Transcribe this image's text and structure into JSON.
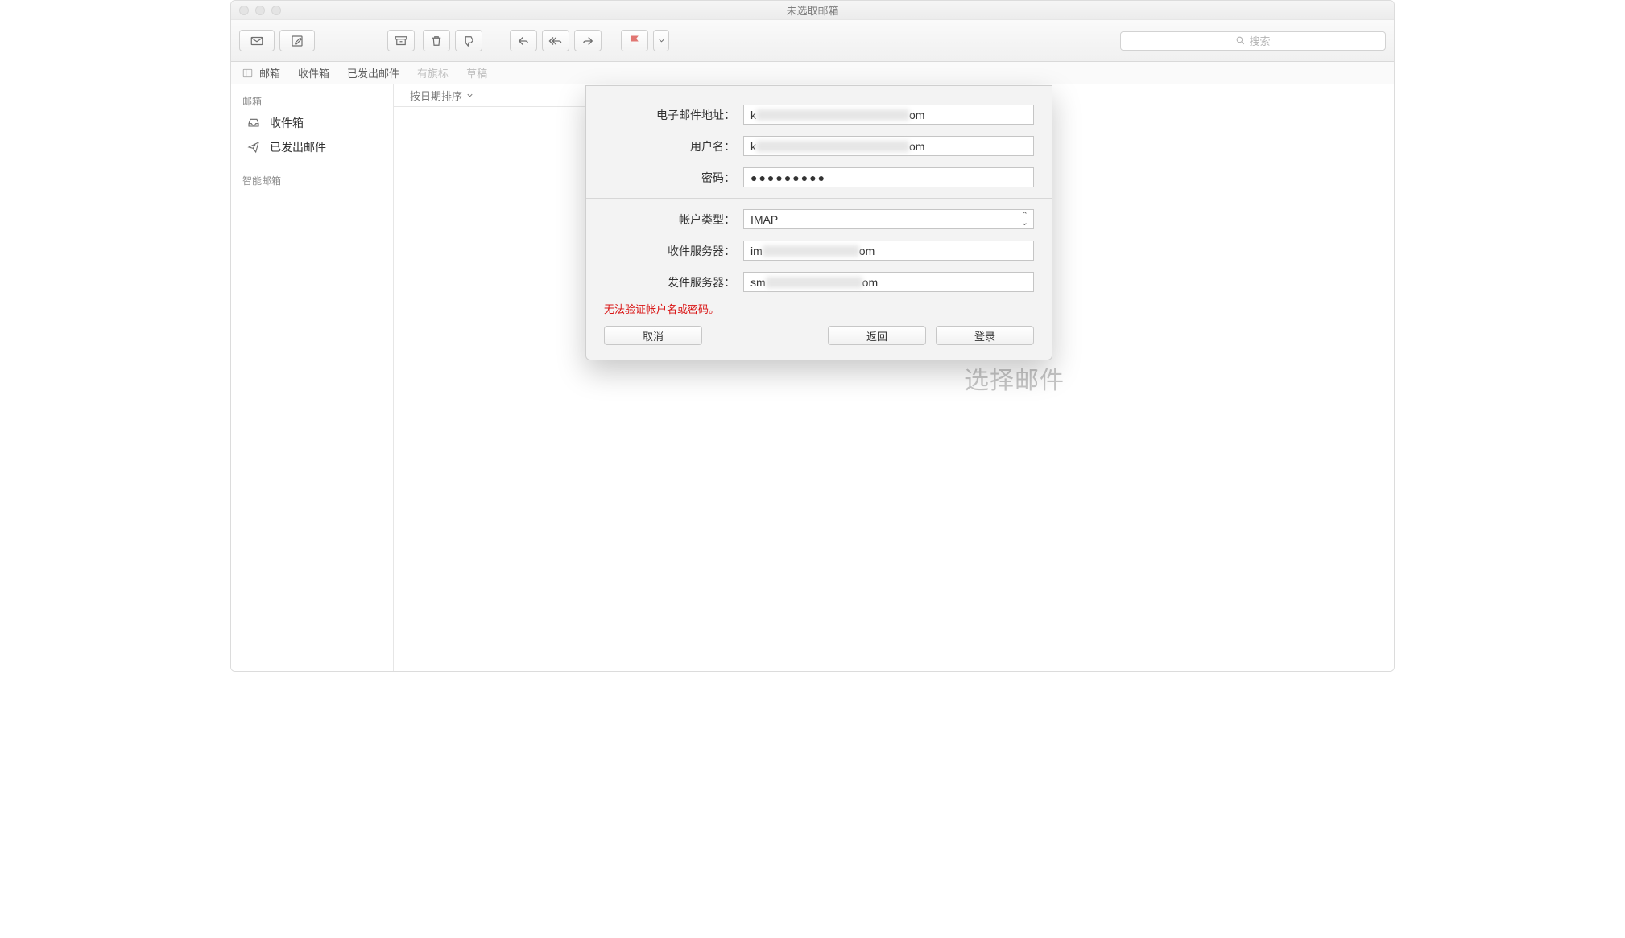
{
  "window": {
    "title": "未选取邮箱"
  },
  "toolbar": {
    "search_placeholder": "搜索"
  },
  "favorites": {
    "toggle_label": "邮箱",
    "items": [
      "收件箱",
      "已发出邮件",
      "有旗标",
      "草稿"
    ]
  },
  "sidebar": {
    "section_mailboxes": "邮箱",
    "inbox": "收件箱",
    "sent": "已发出邮件",
    "section_smart": "智能邮箱"
  },
  "msglist": {
    "sort_label": "按日期排序"
  },
  "preview": {
    "placeholder": "选择邮件"
  },
  "dialog": {
    "email_label": "电子邮件地址：",
    "username_label": "用户名：",
    "password_label": "密码：",
    "account_type_label": "帐户类型：",
    "account_type_value": "IMAP",
    "incoming_label": "收件服务器：",
    "outgoing_label": "发件服务器：",
    "email_prefix": "k",
    "email_suffix": "om",
    "username_prefix": "k",
    "username_suffix": "om",
    "incoming_prefix": "im",
    "incoming_suffix": "om",
    "outgoing_prefix": "sm",
    "outgoing_suffix": "om",
    "password_value": "●●●●●●●●●",
    "error": "无法验证帐户名或密码。",
    "cancel": "取消",
    "back": "返回",
    "signin": "登录"
  }
}
